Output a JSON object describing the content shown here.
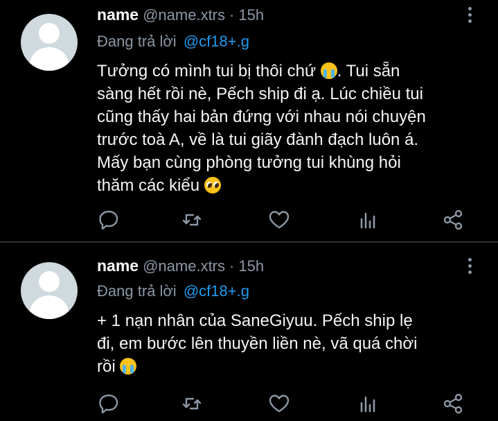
{
  "tweets": [
    {
      "author_name": "name",
      "author_handle": "@name.xtrs",
      "separator": "·",
      "time": "15h",
      "reply_label": "Đang trả lời",
      "reply_mention": "@cf18+.g",
      "lines": [
        {
          "text": "Tưởng có mình tui bị thôi chứ ",
          "emoji": "loudly-crying-face",
          "tail": ". Tui sẵn"
        },
        {
          "text": "sàng hết rồi nè, Pếch ship đi ạ. Lúc chiều tui"
        },
        {
          "text": "cũng thấy hai bản đứng với nhau nói chuyện"
        },
        {
          "text": "trước toà A, về là tui giãy đành đạch luôn á."
        },
        {
          "text": "Mấy bạn cùng phòng tưởng tui khùng hỏi"
        },
        {
          "text": "thăm các kiểu ",
          "emoji": "pleading-face"
        }
      ]
    },
    {
      "author_name": "name",
      "author_handle": "@name.xtrs",
      "separator": "·",
      "time": "15h",
      "reply_label": "Đang trả lời",
      "reply_mention": "@cf18+.g",
      "lines": [
        {
          "text": "+ 1 nạn nhân của SaneGiyuu. Pếch ship lẹ"
        },
        {
          "text": "đi, em bước lên thuyền liền nè, vã quá chời"
        },
        {
          "text": "rồi ",
          "emoji": "loudly-crying-face"
        }
      ]
    }
  ],
  "icons": {
    "reply": "reply-icon",
    "retweet": "retweet-icon",
    "like": "heart-icon",
    "stats": "stats-icon",
    "share": "share-icon",
    "more": "more-vertical-icon"
  },
  "colors": {
    "background": "#000000",
    "text": "#f5f5f5",
    "muted": "#8b98a5",
    "link": "#1d9bf0",
    "divider": "#2f3336"
  }
}
